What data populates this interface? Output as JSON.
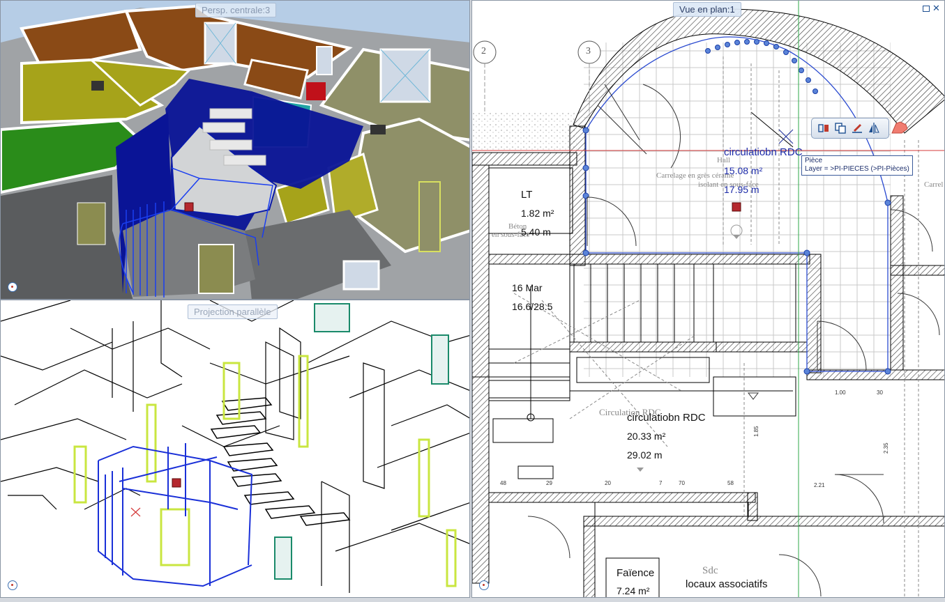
{
  "viewports": {
    "persp": {
      "title": "Persp. centrale:3"
    },
    "para": {
      "title": "Projection parallèle"
    },
    "plan": {
      "title": "Vue en plan:1",
      "grid_labels": [
        "2",
        "3"
      ],
      "rooms": {
        "circ_top": {
          "name": "circulatiobn RDC",
          "area": "15.08 m²",
          "perimeter": "17.95 m",
          "sub": "Hall"
        },
        "lt": {
          "name": "LT",
          "area": "1.82 m²",
          "perimeter": "5.40 m"
        },
        "stairs": {
          "line1": "16 Mar",
          "line2": "16.6/28.5"
        },
        "circ_main": {
          "name": "circulatiobn RDC",
          "area": "20.33 m²",
          "perimeter": "29.02 m",
          "label_grey": "Circulation RDC"
        },
        "faience": {
          "name": "Faïence",
          "area": "7.24 m²"
        },
        "locaux": {
          "name": "locaux associatifs",
          "label_grey": "Sdc"
        }
      },
      "grey_labels": [
        "Carrelage en grès cérame",
        "isolant en sous-face",
        "Béton",
        "en sous-face",
        "Carrel"
      ],
      "tooltip": {
        "line1": "Pièce",
        "line2": "Layer = >PI-PIECES (>PI-Pièces)"
      },
      "toolbar": {
        "icons": [
          "offset-icon",
          "copy-icon",
          "edit-icon",
          "mirror-icon"
        ]
      }
    }
  },
  "colors": {
    "accent_blue": "#1b2aa8",
    "selection_blue": "#0a1aa8",
    "marker_red": "#b5282e",
    "axis_green": "#2ea84a",
    "axis_red": "#d43a3a"
  }
}
